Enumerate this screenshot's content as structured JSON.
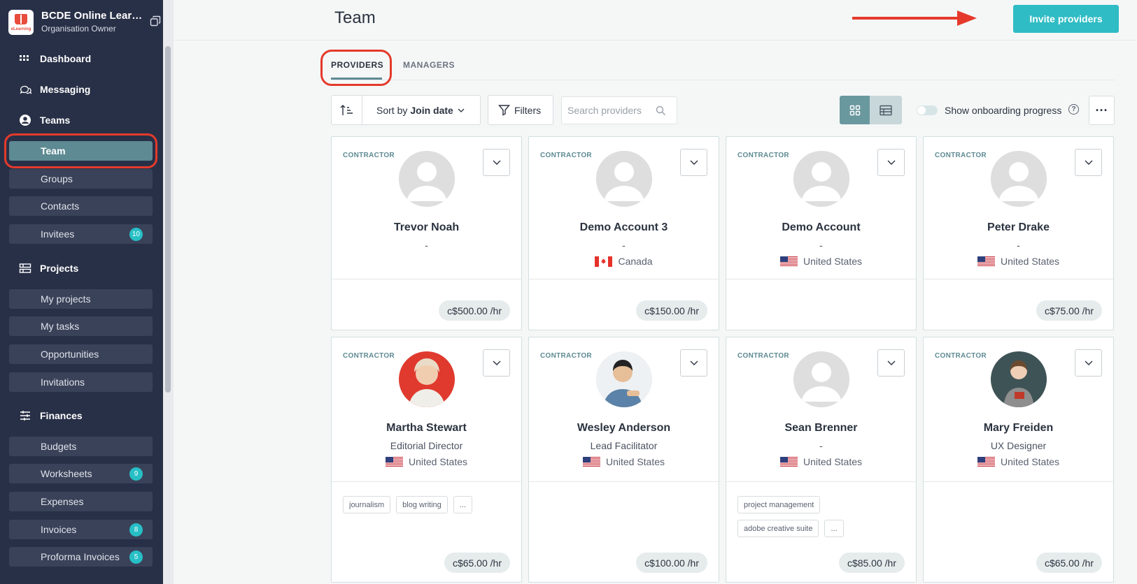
{
  "org": {
    "name": "BCDE Online Learning",
    "role": "Organisation Owner",
    "logo_text": "eLearning"
  },
  "nav": {
    "dashboard": "Dashboard",
    "messaging": "Messaging",
    "teams": "Teams",
    "team": "Team",
    "groups": "Groups",
    "contacts": "Contacts",
    "invitees": "Invitees",
    "invitees_badge": "10",
    "projects": "Projects",
    "my_projects": "My projects",
    "my_tasks": "My tasks",
    "opportunities": "Opportunities",
    "invitations": "Invitations",
    "finances": "Finances",
    "budgets": "Budgets",
    "worksheets": "Worksheets",
    "worksheets_badge": "9",
    "expenses": "Expenses",
    "invoices": "Invoices",
    "invoices_badge": "8",
    "proforma": "Proforma Invoices",
    "proforma_badge": "5"
  },
  "header": {
    "title": "Team",
    "invite_label": "Invite providers"
  },
  "tabs": {
    "providers": "PROVIDERS",
    "managers": "MANAGERS"
  },
  "toolbar": {
    "sort_prefix": "Sort by",
    "sort_value": "Join date",
    "filters_label": "Filters",
    "search_placeholder": "Search providers",
    "onboarding_label": "Show onboarding progress",
    "more": "···"
  },
  "accent": "#2fbcc4",
  "cards": [
    {
      "type": "CONTRACTOR",
      "name": "Trevor Noah",
      "title": "-",
      "country": "",
      "rate": "c$500.00 /hr",
      "tags": []
    },
    {
      "type": "CONTRACTOR",
      "name": "Demo Account 3",
      "title": "-",
      "country": "Canada",
      "rate": "c$150.00 /hr",
      "tags": []
    },
    {
      "type": "CONTRACTOR",
      "name": "Demo Account",
      "title": "-",
      "country": "United States",
      "rate": "",
      "tags": []
    },
    {
      "type": "CONTRACTOR",
      "name": "Peter Drake",
      "title": "-",
      "country": "United States",
      "rate": "c$75.00 /hr",
      "tags": []
    },
    {
      "type": "CONTRACTOR",
      "name": "Martha Stewart",
      "title": "Editorial Director",
      "country": "United States",
      "rate": "c$65.00 /hr",
      "tags": [
        "journalism",
        "blog writing",
        "..."
      ]
    },
    {
      "type": "CONTRACTOR",
      "name": "Wesley Anderson",
      "title": "Lead Facilitator",
      "country": "United States",
      "rate": "c$100.00 /hr",
      "tags": []
    },
    {
      "type": "CONTRACTOR",
      "name": "Sean Brenner",
      "title": "-",
      "country": "United States",
      "rate": "c$85.00 /hr",
      "tags": [
        "project management",
        "adobe creative suite",
        "..."
      ]
    },
    {
      "type": "CONTRACTOR",
      "name": "Mary Freiden",
      "title": "UX Designer",
      "country": "United States",
      "rate": "c$65.00 /hr",
      "tags": []
    }
  ]
}
